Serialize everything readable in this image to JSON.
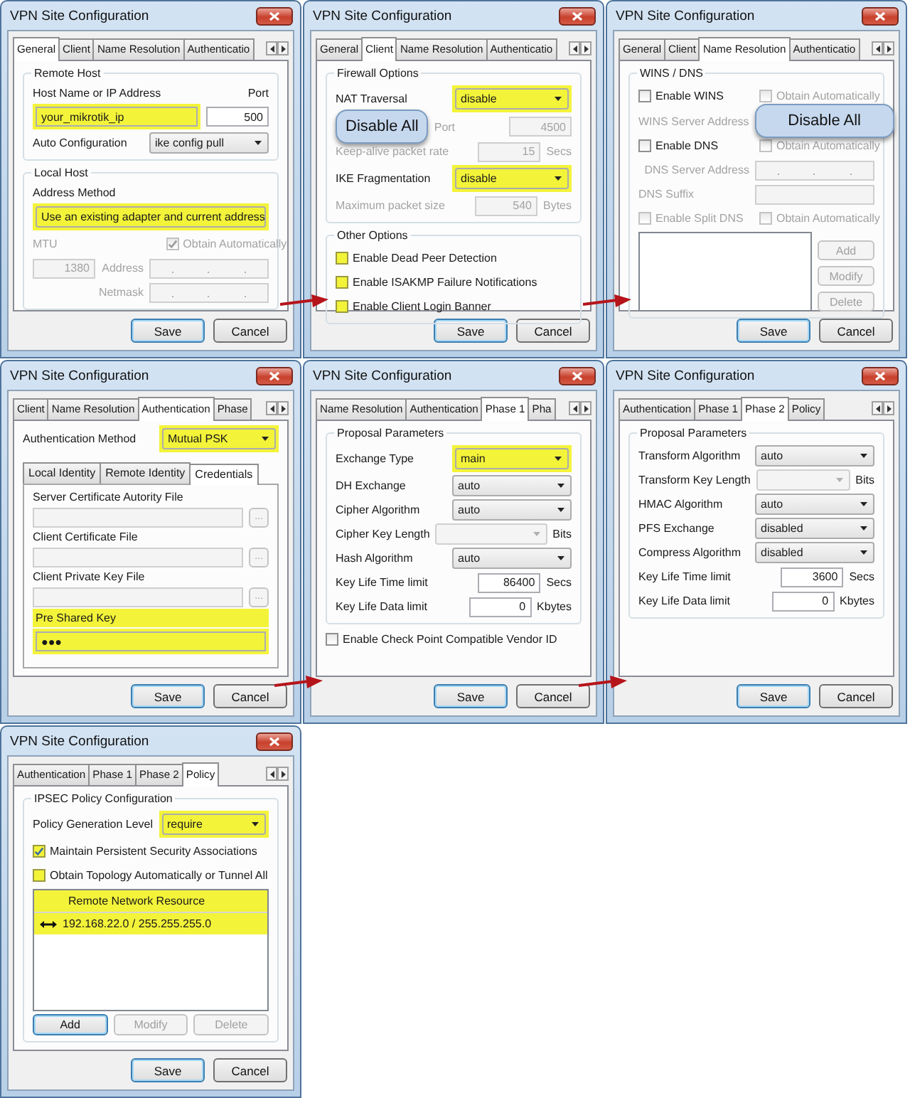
{
  "windows": [
    {
      "title": "VPN Site Configuration",
      "tabs": [
        {
          "label": "General",
          "selected": true
        },
        {
          "label": "Client",
          "selected": false
        },
        {
          "label": "Name Resolution",
          "selected": false
        },
        {
          "label": "Authenticatio",
          "selected": false
        }
      ],
      "items": [
        {
          "kind": "group",
          "title": "Remote Host",
          "items": [
            {
              "kind": "row",
              "cells": [
                {
                  "kind": "label",
                  "text": "Host Name or IP Address"
                },
                {
                  "kind": "label",
                  "text": "Port"
                }
              ]
            },
            {
              "kind": "row",
              "cells": [
                {
                  "kind": "text",
                  "value": "your_mikrotik_ip",
                  "highlighted": true
                },
                {
                  "kind": "number",
                  "value": "500"
                }
              ]
            },
            {
              "kind": "row",
              "cells": [
                {
                  "kind": "label",
                  "text": "Auto Configuration"
                },
                {
                  "kind": "select",
                  "value": "ike config pull"
                }
              ]
            }
          ]
        },
        {
          "kind": "group",
          "title": "Local Host",
          "items": [
            {
              "kind": "row",
              "cells": [
                {
                  "kind": "label",
                  "text": "Address Method"
                }
              ]
            },
            {
              "kind": "row",
              "cells": [
                {
                  "kind": "select",
                  "value": "Use an existing adapter and current address",
                  "highlighted": true
                }
              ]
            },
            {
              "kind": "row",
              "cells": [
                {
                  "kind": "label",
                  "text": "MTU",
                  "disabled": true
                },
                {
                  "kind": "check",
                  "label": "Obtain Automatically",
                  "checked": true,
                  "disabled": true
                }
              ]
            },
            {
              "kind": "row",
              "cells": [
                {
                  "kind": "number",
                  "value": "1380",
                  "disabled": true
                },
                {
                  "kind": "label",
                  "text": "Address",
                  "disabled": true
                },
                {
                  "kind": "ip",
                  "disabled": true
                }
              ]
            },
            {
              "kind": "row",
              "cells": [
                {
                  "kind": "label",
                  "text": "Netmask",
                  "disabled": true
                },
                {
                  "kind": "ip",
                  "disabled": true
                }
              ]
            }
          ]
        }
      ],
      "buttons": [
        {
          "label": "Save",
          "default": true
        },
        {
          "label": "Cancel",
          "default": false
        }
      ]
    },
    {
      "title": "VPN Site Configuration",
      "tabs": [
        {
          "label": "General",
          "selected": false
        },
        {
          "label": "Client",
          "selected": true
        },
        {
          "label": "Name Resolution",
          "selected": false
        },
        {
          "label": "Authenticatio",
          "selected": false
        }
      ],
      "items": [
        {
          "kind": "group",
          "title": "Firewall Options",
          "items": [
            {
              "kind": "row",
              "cells": [
                {
                  "kind": "label",
                  "text": "NAT Traversal"
                },
                {
                  "kind": "select",
                  "value": "disable",
                  "highlighted": true
                }
              ]
            },
            {
              "kind": "row",
              "cells": [
                {
                  "kind": "callout",
                  "text": "Disable All"
                },
                {
                  "kind": "label",
                  "text": "Port",
                  "disabled": true
                },
                {
                  "kind": "number",
                  "value": "4500",
                  "disabled": true
                }
              ]
            },
            {
              "kind": "row",
              "cells": [
                {
                  "kind": "label",
                  "text": "Keep-alive packet rate",
                  "disabled": true
                },
                {
                  "kind": "number",
                  "value": "15",
                  "disabled": true
                },
                {
                  "kind": "unit",
                  "text": "Secs",
                  "disabled": true
                }
              ]
            },
            {
              "kind": "row",
              "cells": [
                {
                  "kind": "label",
                  "text": "IKE Fragmentation"
                },
                {
                  "kind": "select",
                  "value": "disable",
                  "highlighted": true
                }
              ]
            },
            {
              "kind": "row",
              "cells": [
                {
                  "kind": "label",
                  "text": "Maximum packet size",
                  "disabled": true
                },
                {
                  "kind": "number",
                  "value": "540",
                  "disabled": true
                },
                {
                  "kind": "unit",
                  "text": "Bytes",
                  "disabled": true
                }
              ]
            }
          ]
        },
        {
          "kind": "group",
          "title": "Other Options",
          "items": [
            {
              "kind": "row",
              "cells": [
                {
                  "kind": "check",
                  "label": "Enable Dead Peer Detection",
                  "checked": false,
                  "highlighted": true
                }
              ]
            },
            {
              "kind": "row",
              "cells": [
                {
                  "kind": "check",
                  "label": "Enable ISAKMP Failure Notifications",
                  "checked": false,
                  "highlighted": true
                }
              ]
            },
            {
              "kind": "row",
              "cells": [
                {
                  "kind": "check",
                  "label": "Enable Client Login Banner",
                  "checked": false,
                  "highlighted": true
                }
              ]
            }
          ]
        }
      ],
      "buttons": [
        {
          "label": "Save",
          "default": true
        },
        {
          "label": "Cancel",
          "default": false
        }
      ]
    },
    {
      "title": "VPN Site Configuration",
      "tabs": [
        {
          "label": "General",
          "selected": false
        },
        {
          "label": "Client",
          "selected": false
        },
        {
          "label": "Name Resolution",
          "selected": true
        },
        {
          "label": "Authenticatio",
          "selected": false
        }
      ],
      "items": [
        {
          "kind": "group",
          "title": "WINS / DNS",
          "items": [
            {
              "kind": "row",
              "cells": [
                {
                  "kind": "check",
                  "label": "Enable WINS",
                  "checked": false
                },
                {
                  "kind": "check",
                  "label": "Obtain Automatically",
                  "checked": false,
                  "disabled": true
                }
              ]
            },
            {
              "kind": "row",
              "cells": [
                {
                  "kind": "label",
                  "text": "WINS Server Address",
                  "disabled": true
                },
                {
                  "kind": "callout",
                  "text": "Disable All"
                }
              ]
            },
            {
              "kind": "row",
              "cells": [
                {
                  "kind": "check",
                  "label": "Enable DNS",
                  "checked": false
                },
                {
                  "kind": "check",
                  "label": "Obtain Automatically",
                  "checked": false,
                  "disabled": true
                }
              ]
            },
            {
              "kind": "row",
              "cells": [
                {
                  "kind": "label",
                  "text": "DNS Server Address",
                  "disabled": true
                },
                {
                  "kind": "ip",
                  "disabled": true
                }
              ]
            },
            {
              "kind": "row",
              "cells": [
                {
                  "kind": "label",
                  "text": "DNS Suffix",
                  "disabled": true
                },
                {
                  "kind": "text",
                  "disabled": true
                }
              ]
            },
            {
              "kind": "row",
              "cells": [
                {
                  "kind": "check",
                  "label": "Enable Split DNS",
                  "checked": false,
                  "disabled": true
                },
                {
                  "kind": "check",
                  "label": "Obtain Automatically",
                  "checked": false,
                  "disabled": true
                }
              ]
            },
            {
              "kind": "row",
              "cells": [
                {
                  "kind": "list"
                },
                {
                  "kind": "buttons",
                  "buttons": [
                    {
                      "label": "Add",
                      "disabled": true
                    },
                    {
                      "label": "Modify",
                      "disabled": true
                    },
                    {
                      "label": "Delete",
                      "disabled": true
                    }
                  ]
                }
              ]
            }
          ]
        }
      ],
      "buttons": [
        {
          "label": "Save",
          "default": true
        },
        {
          "label": "Cancel",
          "default": false
        }
      ]
    },
    {
      "title": "VPN Site Configuration",
      "tabs": [
        {
          "label": "Client",
          "selected": false
        },
        {
          "label": "Name Resolution",
          "selected": false
        },
        {
          "label": "Authentication",
          "selected": true
        },
        {
          "label": "Phase",
          "selected": false
        }
      ],
      "items": [
        {
          "kind": "row",
          "cells": [
            {
              "kind": "label",
              "text": "Authentication Method"
            },
            {
              "kind": "select",
              "value": "Mutual PSK",
              "highlighted": true
            }
          ]
        },
        {
          "kind": "tabpanel",
          "tabs": [
            {
              "label": "Local Identity",
              "selected": false
            },
            {
              "label": "Remote Identity",
              "selected": false
            },
            {
              "label": "Credentials",
              "selected": true
            }
          ],
          "items": [
            {
              "kind": "row",
              "cells": [
                {
                  "kind": "label",
                  "text": "Server Certificate Autority File"
                }
              ]
            },
            {
              "kind": "row",
              "cells": [
                {
                  "kind": "text",
                  "disabled": true
                },
                {
                  "kind": "button",
                  "label": "...",
                  "disabled": true
                }
              ]
            },
            {
              "kind": "row",
              "cells": [
                {
                  "kind": "label",
                  "text": "Client Certificate File"
                }
              ]
            },
            {
              "kind": "row",
              "cells": [
                {
                  "kind": "text",
                  "disabled": true
                },
                {
                  "kind": "button",
                  "label": "...",
                  "disabled": true
                }
              ]
            },
            {
              "kind": "row",
              "cells": [
                {
                  "kind": "label",
                  "text": "Client Private Key File"
                }
              ]
            },
            {
              "kind": "row",
              "cells": [
                {
                  "kind": "text",
                  "disabled": true
                },
                {
                  "kind": "button",
                  "label": "...",
                  "disabled": true
                }
              ]
            },
            {
              "kind": "row",
              "cells": [
                {
                  "kind": "label",
                  "text": "Pre Shared Key",
                  "highlighted": true
                }
              ]
            },
            {
              "kind": "row",
              "cells": [
                {
                  "kind": "text",
                  "value": "●●●",
                  "highlighted": true
                }
              ]
            }
          ]
        }
      ],
      "buttons": [
        {
          "label": "Save",
          "default": true
        },
        {
          "label": "Cancel",
          "default": false
        }
      ]
    },
    {
      "title": "VPN Site Configuration",
      "tabs": [
        {
          "label": "Name Resolution",
          "selected": false
        },
        {
          "label": "Authentication",
          "selected": false
        },
        {
          "label": "Phase 1",
          "selected": true
        },
        {
          "label": "Pha",
          "selected": false
        }
      ],
      "items": [
        {
          "kind": "group",
          "title": "Proposal Parameters",
          "items": [
            {
              "kind": "row",
              "cells": [
                {
                  "kind": "label",
                  "text": "Exchange Type"
                },
                {
                  "kind": "select",
                  "value": "main",
                  "highlighted": true
                }
              ]
            },
            {
              "kind": "row",
              "cells": [
                {
                  "kind": "label",
                  "text": "DH Exchange"
                },
                {
                  "kind": "select",
                  "value": "auto"
                }
              ]
            },
            {
              "kind": "row",
              "cells": [
                {
                  "kind": "label",
                  "text": "Cipher Algorithm"
                },
                {
                  "kind": "select",
                  "value": "auto"
                }
              ]
            },
            {
              "kind": "row",
              "cells": [
                {
                  "kind": "label",
                  "text": "Cipher Key Length"
                },
                {
                  "kind": "select",
                  "disabled": true
                },
                {
                  "kind": "unit",
                  "text": "Bits"
                }
              ]
            },
            {
              "kind": "row",
              "cells": [
                {
                  "kind": "label",
                  "text": "Hash Algorithm"
                },
                {
                  "kind": "select",
                  "value": "auto"
                }
              ]
            },
            {
              "kind": "row",
              "cells": [
                {
                  "kind": "label",
                  "text": "Key Life Time limit"
                },
                {
                  "kind": "number",
                  "value": "86400"
                },
                {
                  "kind": "unit",
                  "text": "Secs"
                }
              ]
            },
            {
              "kind": "row",
              "cells": [
                {
                  "kind": "label",
                  "text": "Key Life Data limit"
                },
                {
                  "kind": "number",
                  "value": "0"
                },
                {
                  "kind": "unit",
                  "text": "Kbytes"
                }
              ]
            }
          ]
        },
        {
          "kind": "row",
          "cells": [
            {
              "kind": "check",
              "label": "Enable Check Point Compatible Vendor ID",
              "checked": false
            }
          ]
        }
      ],
      "buttons": [
        {
          "label": "Save",
          "default": true
        },
        {
          "label": "Cancel",
          "default": false
        }
      ]
    },
    {
      "title": "VPN Site Configuration",
      "tabs": [
        {
          "label": "Authentication",
          "selected": false
        },
        {
          "label": "Phase 1",
          "selected": false
        },
        {
          "label": "Phase 2",
          "selected": true
        },
        {
          "label": "Policy",
          "selected": false
        }
      ],
      "items": [
        {
          "kind": "group",
          "title": "Proposal Parameters",
          "items": [
            {
              "kind": "row",
              "cells": [
                {
                  "kind": "label",
                  "text": "Transform Algorithm"
                },
                {
                  "kind": "select",
                  "value": "auto"
                }
              ]
            },
            {
              "kind": "row",
              "cells": [
                {
                  "kind": "label",
                  "text": "Transform Key Length"
                },
                {
                  "kind": "select",
                  "disabled": true
                },
                {
                  "kind": "unit",
                  "text": "Bits"
                }
              ]
            },
            {
              "kind": "row",
              "cells": [
                {
                  "kind": "label",
                  "text": "HMAC Algorithm"
                },
                {
                  "kind": "select",
                  "value": "auto"
                }
              ]
            },
            {
              "kind": "row",
              "cells": [
                {
                  "kind": "label",
                  "text": "PFS Exchange"
                },
                {
                  "kind": "select",
                  "value": "disabled"
                }
              ]
            },
            {
              "kind": "row",
              "cells": [
                {
                  "kind": "label",
                  "text": "Compress Algorithm"
                },
                {
                  "kind": "select",
                  "value": "disabled"
                }
              ]
            },
            {
              "kind": "row",
              "cells": [
                {
                  "kind": "label",
                  "text": "Key Life Time limit"
                },
                {
                  "kind": "number",
                  "value": "3600"
                },
                {
                  "kind": "unit",
                  "text": "Secs"
                }
              ]
            },
            {
              "kind": "row",
              "cells": [
                {
                  "kind": "label",
                  "text": "Key Life Data limit"
                },
                {
                  "kind": "number",
                  "value": "0"
                },
                {
                  "kind": "unit",
                  "text": "Kbytes"
                }
              ]
            }
          ]
        }
      ],
      "buttons": [
        {
          "label": "Save",
          "default": true
        },
        {
          "label": "Cancel",
          "default": false
        }
      ]
    },
    {
      "title": "VPN Site Configuration",
      "tabs": [
        {
          "label": "Authentication",
          "selected": false
        },
        {
          "label": "Phase 1",
          "selected": false
        },
        {
          "label": "Phase 2",
          "selected": false
        },
        {
          "label": "Policy",
          "selected": true
        }
      ],
      "items": [
        {
          "kind": "group",
          "title": "IPSEC Policy Configuration",
          "items": [
            {
              "kind": "row",
              "cells": [
                {
                  "kind": "label",
                  "text": "Policy Generation Level"
                },
                {
                  "kind": "select",
                  "value": "require",
                  "highlighted": true
                }
              ]
            },
            {
              "kind": "row",
              "cells": [
                {
                  "kind": "check",
                  "label": "Maintain Persistent Security Associations",
                  "checked": true,
                  "highlighted": true
                }
              ]
            },
            {
              "kind": "row",
              "cells": [
                {
                  "kind": "check",
                  "label": "Obtain Topology Automatically or Tunnel All",
                  "checked": false,
                  "highlighted": true
                }
              ]
            },
            {
              "kind": "row",
              "cells": [
                {
                  "kind": "list",
                  "header": "Remote Network Resource",
                  "rows": [
                    "192.168.22.0 / 255.255.255.0"
                  ],
                  "highlighted": true
                }
              ]
            },
            {
              "kind": "row",
              "cells": [
                {
                  "kind": "button",
                  "label": "Add",
                  "default": true
                },
                {
                  "kind": "button",
                  "label": "Modify",
                  "disabled": true
                },
                {
                  "kind": "button",
                  "label": "Delete",
                  "disabled": true
                }
              ]
            }
          ]
        }
      ],
      "buttons": [
        {
          "label": "Save",
          "default": true
        },
        {
          "label": "Cancel",
          "default": false
        }
      ]
    }
  ]
}
